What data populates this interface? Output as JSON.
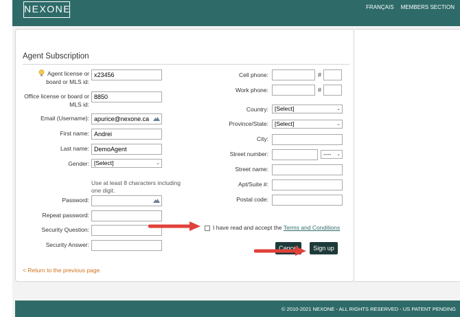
{
  "header": {
    "logo": "NEXONE",
    "nav_french": "FRANÇAIS",
    "nav_members": "MEMBERS SECTION"
  },
  "form": {
    "title": "Agent Subscription",
    "agent_license_label": "Agent license or board or MLS id:",
    "agent_license_value": "x23456",
    "office_license_label": "Office license or board or MLS id:",
    "office_license_value": "8850",
    "email_label": "Email (Username):",
    "email_value": "apurice@nexone.ca",
    "first_name_label": "First name:",
    "first_name_value": "Andrei",
    "last_name_label": "Last name:",
    "last_name_value": "DemoAgent",
    "gender_label": "Gender:",
    "gender_value": "[Select]",
    "password_hint": "Use at least 8 characters including one digit.",
    "password_label": "Password:",
    "password_value": "",
    "repeat_password_label": "Repeat password:",
    "security_question_label": "Security Question:",
    "security_answer_label": "Security Answer:",
    "cell_phone_label": "Cell phone:",
    "work_phone_label": "Work phone:",
    "hash": "#",
    "country_label": "Country:",
    "country_value": "[Select]",
    "province_label": "Province/State:",
    "province_value": "[Select]",
    "city_label": "City:",
    "street_number_label": "Street number:",
    "street_suffix_value": "----",
    "street_name_label": "Street name:",
    "apt_label": "Apt/Suite #:",
    "postal_label": "Postal code:",
    "terms_prefix": "I have read and accept the",
    "terms_link": "Terms and Conditions",
    "cancel_label": "Cancel",
    "signup_label": "Sign up",
    "return_link": "< Return to the previous page"
  },
  "footer": {
    "text": "© 2010-2021 NEXONE - ALL RIGHTS RESERVED - US PATENT PENDING"
  },
  "colors": {
    "brand": "#2e6b68",
    "button": "#1f3b39",
    "arrow": "#e0413a",
    "link_orange": "#d1711a"
  },
  "icons": [
    "lightbulb-icon",
    "key-icon",
    "chevron-down-icon",
    "arrow-icon"
  ]
}
